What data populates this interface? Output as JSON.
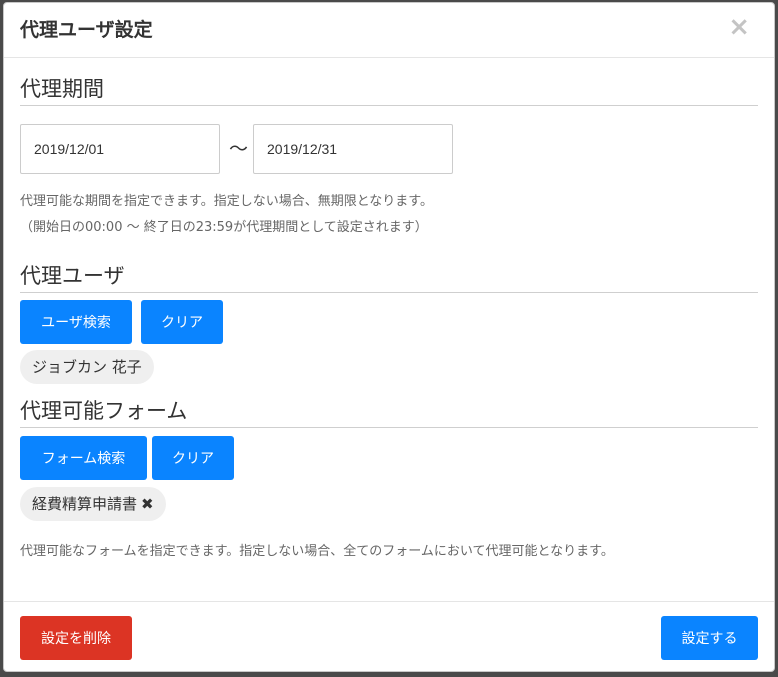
{
  "modal": {
    "title": "代理ユーザ設定",
    "close_label": "×"
  },
  "period": {
    "heading": "代理期間",
    "start_value": "2019/12/01",
    "separator": "〜",
    "end_value": "2019/12/31",
    "help_line1": "代理可能な期間を指定できます。指定しない場合、無期限となります。",
    "help_line2": "（開始日の00:00 〜 終了日の23:59が代理期間として設定されます）"
  },
  "proxy_user": {
    "heading": "代理ユーザ",
    "search_label": "ユーザ検索",
    "clear_label": "クリア",
    "selected_user": "ジョブカン 花子"
  },
  "forms": {
    "heading": "代理可能フォーム",
    "search_label": "フォーム検索",
    "clear_label": "クリア",
    "selected_form": "経費精算申請書",
    "remove_label": "✖",
    "help": "代理可能なフォームを指定できます。指定しない場合、全てのフォームにおいて代理可能となります。"
  },
  "footer": {
    "delete_label": "設定を削除",
    "submit_label": "設定する"
  },
  "colors": {
    "primary": "#0a84ff",
    "danger": "#dc3424"
  }
}
